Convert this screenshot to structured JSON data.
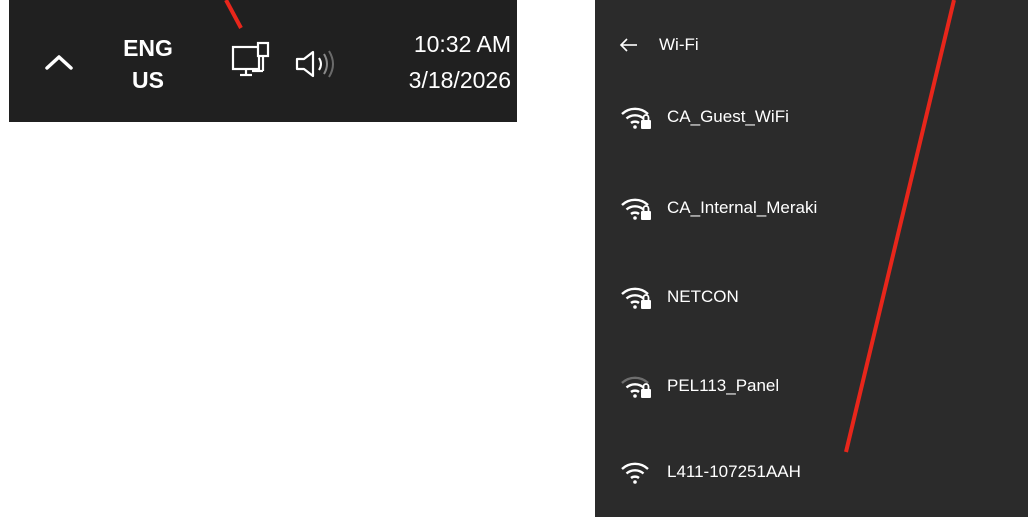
{
  "taskbar": {
    "chevron_icon": "chevron-up-icon",
    "language_line1": "ENG",
    "language_line2": "US",
    "network_icon": "wired-network-icon",
    "volume_icon": "speaker-icon",
    "time": "10:32 AM",
    "date": "3/18/2026"
  },
  "wifi_panel": {
    "back_icon": "back-arrow-icon",
    "title": "Wi-Fi",
    "networks": [
      {
        "ssid": "CA_Guest_WiFi",
        "secured": true
      },
      {
        "ssid": "CA_Internal_Meraki",
        "secured": true
      },
      {
        "ssid": "NETCON",
        "secured": true
      },
      {
        "ssid": "PEL113_Panel",
        "secured": true,
        "signal": "weak"
      },
      {
        "ssid": "L411-107251AAH",
        "secured": false
      }
    ]
  },
  "colors": {
    "taskbar_bg": "#202020",
    "flyout_bg": "#2b2b2b",
    "annotation": "#e8261b"
  }
}
